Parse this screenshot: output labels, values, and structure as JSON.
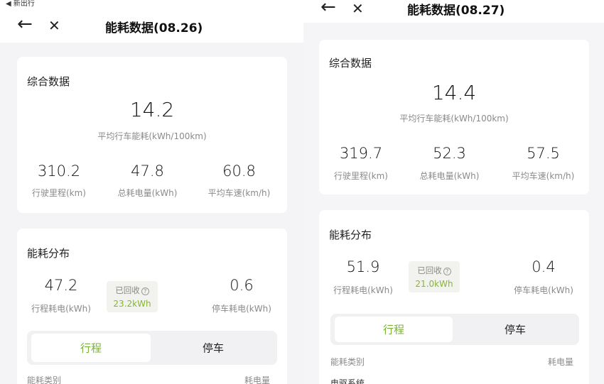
{
  "left": {
    "status_back_label": "◀ 新出行",
    "title": "能耗数据(08.26)",
    "summary": {
      "title": "综合数据",
      "main_value": "14.2",
      "main_label": "平均行车能耗(kWh/100km)",
      "stats": [
        {
          "value": "310.2",
          "label": "行驶里程(km)"
        },
        {
          "value": "47.8",
          "label": "总耗电量(kWh)"
        },
        {
          "value": "60.8",
          "label": "平均车速(km/h)"
        }
      ]
    },
    "distribution": {
      "title": "能耗分布",
      "driving_value": "47.2",
      "driving_label": "行程耗电(kWh)",
      "recovered_label": "已回收",
      "recovered_value": "23.2kWh",
      "parking_value": "0.6",
      "parking_label": "停车耗电(kWh)",
      "tabs": [
        "行程",
        "停车"
      ],
      "active_tab": "行程",
      "table_header_left": "能耗类别",
      "table_header_right": "耗电量"
    }
  },
  "right": {
    "title": "能耗数据(08.27)",
    "summary": {
      "title": "综合数据",
      "main_value": "14.4",
      "main_label": "平均行车能耗(kWh/100km)",
      "stats": [
        {
          "value": "319.7",
          "label": "行驶里程(km)"
        },
        {
          "value": "52.3",
          "label": "总耗电量(kWh)"
        },
        {
          "value": "57.5",
          "label": "平均车速(km/h)"
        }
      ]
    },
    "distribution": {
      "title": "能耗分布",
      "driving_value": "51.9",
      "driving_label": "行程耗电(kWh)",
      "recovered_label": "已回收",
      "recovered_value": "21.0kWh",
      "parking_value": "0.4",
      "parking_label": "停车耗电(kWh)",
      "tabs": [
        "行程",
        "停车"
      ],
      "active_tab": "行程",
      "table_header_left": "能耗类别",
      "table_header_right": "耗电量",
      "first_row_label": "电驱系统"
    }
  },
  "icons": {
    "back": "arrow-left-icon",
    "close": "close-x-icon",
    "help": "question-circle-icon"
  },
  "colors": {
    "accent_green": "#7bb13a",
    "recovered_green": "#86b532",
    "card_bg": "#ffffff",
    "page_bg": "#f4f4f6"
  }
}
